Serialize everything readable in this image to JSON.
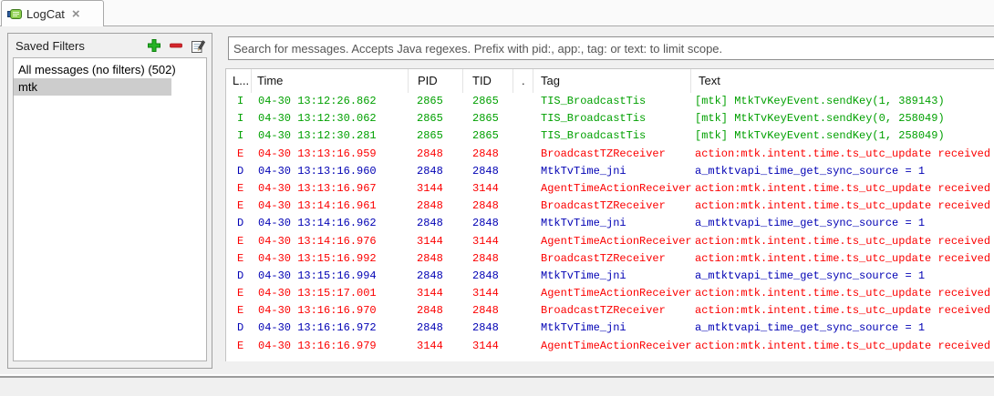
{
  "tab": {
    "title": "LogCat"
  },
  "filters_panel": {
    "title": "Saved Filters",
    "items": [
      {
        "label": "All messages (no filters) (502)",
        "selected": false
      },
      {
        "label": "mtk",
        "selected": true
      }
    ]
  },
  "search": {
    "placeholder": "Search for messages. Accepts Java regexes. Prefix with pid:, app:, tag: or text: to limit scope."
  },
  "icons": {
    "add": "add-filter",
    "remove": "remove-filter",
    "edit": "edit-filter",
    "close": "×"
  },
  "log_table": {
    "columns": {
      "level": "L...",
      "time": "Time",
      "pid": "PID",
      "tid": "TID",
      "app": ".",
      "tag": "Tag",
      "text": "Text"
    },
    "level_colors": {
      "I": "#00a000",
      "E": "#fb0000",
      "D": "#0000b4"
    },
    "rows": [
      {
        "level": "I",
        "time": "04-30 13:12:26.862",
        "pid": "2865",
        "tid": "2865",
        "tag": "TIS_BroadcastTis",
        "text": "[mtk] MtkTvKeyEvent.sendKey(1, 389143)"
      },
      {
        "level": "I",
        "time": "04-30 13:12:30.062",
        "pid": "2865",
        "tid": "2865",
        "tag": "TIS_BroadcastTis",
        "text": "[mtk] MtkTvKeyEvent.sendKey(0, 258049)"
      },
      {
        "level": "I",
        "time": "04-30 13:12:30.281",
        "pid": "2865",
        "tid": "2865",
        "tag": "TIS_BroadcastTis",
        "text": "[mtk] MtkTvKeyEvent.sendKey(1, 258049)"
      },
      {
        "level": "E",
        "time": "04-30 13:13:16.959",
        "pid": "2848",
        "tid": "2848",
        "tag": "BroadcastTZReceiver",
        "text": "action:mtk.intent.time.ts_utc_update received"
      },
      {
        "level": "D",
        "time": "04-30 13:13:16.960",
        "pid": "2848",
        "tid": "2848",
        "tag": "MtkTvTime_jni",
        "text": "a_mtktvapi_time_get_sync_source = 1"
      },
      {
        "level": "E",
        "time": "04-30 13:13:16.967",
        "pid": "3144",
        "tid": "3144",
        "tag": "AgentTimeActionReceiver",
        "text": "action:mtk.intent.time.ts_utc_update received"
      },
      {
        "level": "E",
        "time": "04-30 13:14:16.961",
        "pid": "2848",
        "tid": "2848",
        "tag": "BroadcastTZReceiver",
        "text": "action:mtk.intent.time.ts_utc_update received"
      },
      {
        "level": "D",
        "time": "04-30 13:14:16.962",
        "pid": "2848",
        "tid": "2848",
        "tag": "MtkTvTime_jni",
        "text": "a_mtktvapi_time_get_sync_source = 1"
      },
      {
        "level": "E",
        "time": "04-30 13:14:16.976",
        "pid": "3144",
        "tid": "3144",
        "tag": "AgentTimeActionReceiver",
        "text": "action:mtk.intent.time.ts_utc_update received"
      },
      {
        "level": "E",
        "time": "04-30 13:15:16.992",
        "pid": "2848",
        "tid": "2848",
        "tag": "BroadcastTZReceiver",
        "text": "action:mtk.intent.time.ts_utc_update received"
      },
      {
        "level": "D",
        "time": "04-30 13:15:16.994",
        "pid": "2848",
        "tid": "2848",
        "tag": "MtkTvTime_jni",
        "text": "a_mtktvapi_time_get_sync_source = 1"
      },
      {
        "level": "E",
        "time": "04-30 13:15:17.001",
        "pid": "3144",
        "tid": "3144",
        "tag": "AgentTimeActionReceiver",
        "text": "action:mtk.intent.time.ts_utc_update received"
      },
      {
        "level": "E",
        "time": "04-30 13:16:16.970",
        "pid": "2848",
        "tid": "2848",
        "tag": "BroadcastTZReceiver",
        "text": "action:mtk.intent.time.ts_utc_update received"
      },
      {
        "level": "D",
        "time": "04-30 13:16:16.972",
        "pid": "2848",
        "tid": "2848",
        "tag": "MtkTvTime_jni",
        "text": "a_mtktvapi_time_get_sync_source = 1"
      },
      {
        "level": "E",
        "time": "04-30 13:16:16.979",
        "pid": "3144",
        "tid": "3144",
        "tag": "AgentTimeActionReceiver",
        "text": "action:mtk.intent.time.ts_utc_update received"
      }
    ]
  }
}
